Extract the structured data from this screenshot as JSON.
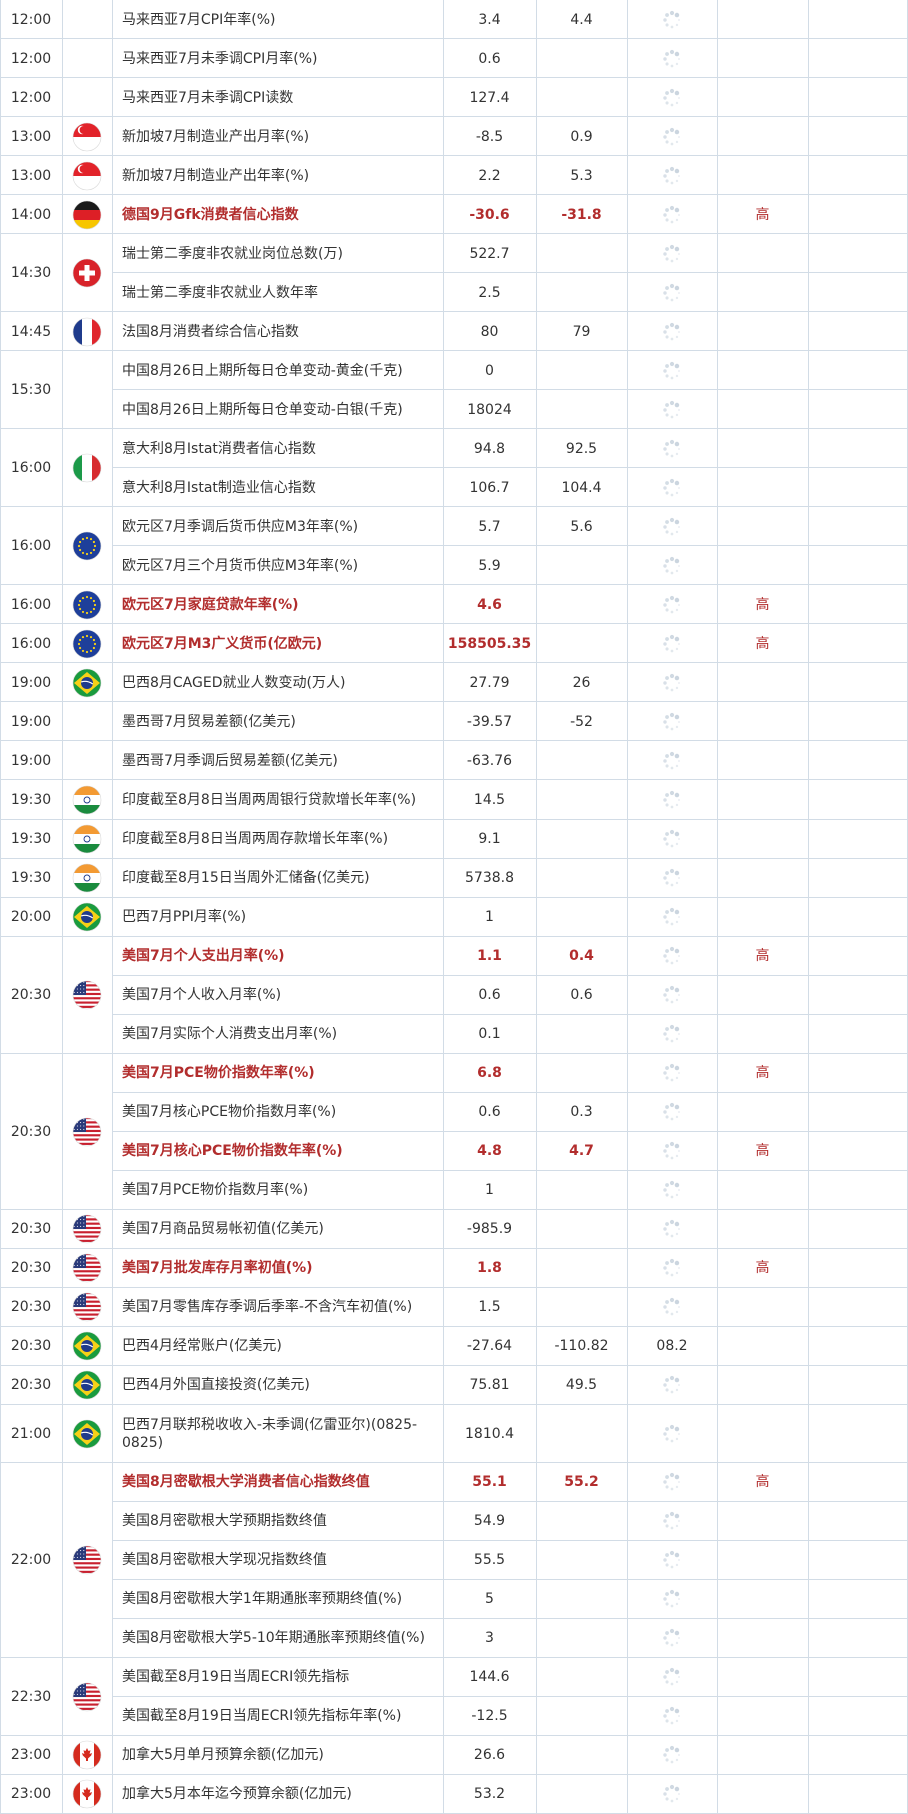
{
  "rows": [
    {
      "time": "12:00",
      "country": "",
      "name": "马来西亚7月CPI年率(%)",
      "actual": "3.4",
      "forecast": "4.4",
      "previous": "",
      "impact": "",
      "important": false
    },
    {
      "time": "12:00",
      "country": "",
      "name": "马来西亚7月未季调CPI月率(%)",
      "actual": "0.6",
      "forecast": "",
      "previous": "",
      "impact": "",
      "important": false
    },
    {
      "time": "12:00",
      "country": "",
      "name": "马来西亚7月未季调CPI读数",
      "actual": "127.4",
      "forecast": "",
      "previous": "",
      "impact": "",
      "important": false
    },
    {
      "time": "13:00",
      "country": "singapore",
      "name": "新加坡7月制造业产出月率(%)",
      "actual": "-8.5",
      "forecast": "0.9",
      "previous": "",
      "impact": "",
      "important": false
    },
    {
      "time": "13:00",
      "country": "singapore",
      "name": "新加坡7月制造业产出年率(%)",
      "actual": "2.2",
      "forecast": "5.3",
      "previous": "",
      "impact": "",
      "important": false
    },
    {
      "time": "14:00",
      "country": "germany",
      "name": "德国9月Gfk消费者信心指数",
      "actual": "-30.6",
      "forecast": "-31.8",
      "previous": "",
      "impact": "高",
      "important": true
    },
    {
      "time": "14:30",
      "country": "switzerland",
      "name": "瑞士第二季度非农就业岗位总数(万)",
      "actual": "522.7",
      "forecast": "",
      "previous": "",
      "impact": "",
      "important": false
    },
    {
      "time": "14:30",
      "country": "switzerland",
      "name": "瑞士第二季度非农就业人数年率",
      "actual": "2.5",
      "forecast": "",
      "previous": "",
      "impact": "",
      "important": false
    },
    {
      "time": "14:45",
      "country": "france",
      "name": "法国8月消费者综合信心指数",
      "actual": "80",
      "forecast": "79",
      "previous": "",
      "impact": "",
      "important": false
    },
    {
      "time": "15:30",
      "country": "",
      "name": "中国8月26日上期所每日仓单变动-黄金(千克)",
      "actual": "0",
      "forecast": "",
      "previous": "",
      "impact": "",
      "important": false
    },
    {
      "time": "15:30",
      "country": "",
      "name": "中国8月26日上期所每日仓单变动-白银(千克)",
      "actual": "18024",
      "forecast": "",
      "previous": "",
      "impact": "",
      "important": false
    },
    {
      "time": "16:00",
      "country": "italy",
      "name": "意大利8月Istat消费者信心指数",
      "actual": "94.8",
      "forecast": "92.5",
      "previous": "",
      "impact": "",
      "important": false
    },
    {
      "time": "16:00",
      "country": "italy",
      "name": "意大利8月Istat制造业信心指数",
      "actual": "106.7",
      "forecast": "104.4",
      "previous": "",
      "impact": "",
      "important": false
    },
    {
      "time": "16:00",
      "country": "eu",
      "name": "欧元区7月季调后货币供应M3年率(%)",
      "actual": "5.7",
      "forecast": "5.6",
      "previous": "",
      "impact": "",
      "important": false
    },
    {
      "time": "16:00",
      "country": "eu",
      "name": "欧元区7月三个月货币供应M3年率(%)",
      "actual": "5.9",
      "forecast": "",
      "previous": "",
      "impact": "",
      "important": false
    },
    {
      "time": "16:00",
      "country": "eu",
      "name": "欧元区7月家庭贷款年率(%)",
      "actual": "4.6",
      "forecast": "",
      "previous": "",
      "impact": "高",
      "important": true
    },
    {
      "time": "16:00",
      "country": "eu",
      "name": "欧元区7月M3广义货币(亿欧元)",
      "actual": "158505.35",
      "forecast": "",
      "previous": "",
      "impact": "高",
      "important": true
    },
    {
      "time": "19:00",
      "country": "brazil",
      "name": "巴西8月CAGED就业人数变动(万人)",
      "actual": "27.79",
      "forecast": "26",
      "previous": "",
      "impact": "",
      "important": false
    },
    {
      "time": "19:00",
      "country": "",
      "name": "墨西哥7月贸易差额(亿美元)",
      "actual": "-39.57",
      "forecast": "-52",
      "previous": "",
      "impact": "",
      "important": false
    },
    {
      "time": "19:00",
      "country": "",
      "name": "墨西哥7月季调后贸易差额(亿美元)",
      "actual": "-63.76",
      "forecast": "",
      "previous": "",
      "impact": "",
      "important": false
    },
    {
      "time": "19:30",
      "country": "india",
      "name": "印度截至8月8日当周两周银行贷款增长年率(%)",
      "actual": "14.5",
      "forecast": "",
      "previous": "",
      "impact": "",
      "important": false
    },
    {
      "time": "19:30",
      "country": "india",
      "name": "印度截至8月8日当周两周存款增长年率(%)",
      "actual": "9.1",
      "forecast": "",
      "previous": "",
      "impact": "",
      "important": false
    },
    {
      "time": "19:30",
      "country": "india",
      "name": "印度截至8月15日当周外汇储备(亿美元)",
      "actual": "5738.8",
      "forecast": "",
      "previous": "",
      "impact": "",
      "important": false
    },
    {
      "time": "20:00",
      "country": "brazil",
      "name": "巴西7月PPI月率(%)",
      "actual": "1",
      "forecast": "",
      "previous": "",
      "impact": "",
      "important": false
    },
    {
      "time": "20:30",
      "country": "usa",
      "name": "美国7月个人支出月率(%)",
      "actual": "1.1",
      "forecast": "0.4",
      "previous": "",
      "impact": "高",
      "important": true
    },
    {
      "time": "20:30",
      "country": "usa",
      "name": "美国7月个人收入月率(%)",
      "actual": "0.6",
      "forecast": "0.6",
      "previous": "",
      "impact": "",
      "important": false
    },
    {
      "time": "20:30",
      "country": "usa",
      "name": "美国7月实际个人消费支出月率(%)",
      "actual": "0.1",
      "forecast": "",
      "previous": "",
      "impact": "",
      "important": false
    },
    {
      "time": "20:30",
      "country": "usa",
      "name": "美国7月PCE物价指数年率(%)",
      "actual": "6.8",
      "forecast": "",
      "previous": "",
      "impact": "高",
      "important": true
    },
    {
      "time": "20:30",
      "country": "usa",
      "name": "美国7月核心PCE物价指数月率(%)",
      "actual": "0.6",
      "forecast": "0.3",
      "previous": "",
      "impact": "",
      "important": false
    },
    {
      "time": "20:30",
      "country": "usa",
      "name": "美国7月核心PCE物价指数年率(%)",
      "actual": "4.8",
      "forecast": "4.7",
      "previous": "",
      "impact": "高",
      "important": true
    },
    {
      "time": "20:30",
      "country": "usa",
      "name": "美国7月PCE物价指数月率(%)",
      "actual": "1",
      "forecast": "",
      "previous": "",
      "impact": "",
      "important": false
    },
    {
      "time": "20:30",
      "country": "usa",
      "name": "美国7月商品贸易帐初值(亿美元)",
      "actual": "-985.9",
      "forecast": "",
      "previous": "",
      "impact": "",
      "important": false
    },
    {
      "time": "20:30",
      "country": "usa",
      "name": "美国7月批发库存月率初值(%)",
      "actual": "1.8",
      "forecast": "",
      "previous": "",
      "impact": "高",
      "important": true
    },
    {
      "time": "20:30",
      "country": "usa",
      "name": "美国7月零售库存季调后季率-不含汽车初值(%)",
      "actual": "1.5",
      "forecast": "",
      "previous": "",
      "impact": "",
      "important": false
    },
    {
      "time": "20:30",
      "country": "brazil",
      "name": "巴西4月经常账户(亿美元)",
      "actual": "-27.64",
      "forecast": "-110.82",
      "previous": "08.2",
      "impact": "",
      "important": false
    },
    {
      "time": "20:30",
      "country": "brazil",
      "name": "巴西4月外国直接投资(亿美元)",
      "actual": "75.81",
      "forecast": "49.5",
      "previous": "",
      "impact": "",
      "important": false
    },
    {
      "time": "21:00",
      "country": "brazil",
      "name": "巴西7月联邦税收收入-未季调(亿雷亚尔)(0825-0825)",
      "actual": "1810.4",
      "forecast": "",
      "previous": "",
      "impact": "",
      "important": false
    },
    {
      "time": "22:00",
      "country": "usa",
      "name": "美国8月密歇根大学消费者信心指数终值",
      "actual": "55.1",
      "forecast": "55.2",
      "previous": "",
      "impact": "高",
      "important": true
    },
    {
      "time": "22:00",
      "country": "usa",
      "name": "美国8月密歇根大学预期指数终值",
      "actual": "54.9",
      "forecast": "",
      "previous": "",
      "impact": "",
      "important": false
    },
    {
      "time": "22:00",
      "country": "usa",
      "name": "美国8月密歇根大学现况指数终值",
      "actual": "55.5",
      "forecast": "",
      "previous": "",
      "impact": "",
      "important": false
    },
    {
      "time": "22:00",
      "country": "usa",
      "name": "美国8月密歇根大学1年期通胀率预期终值(%)",
      "actual": "5",
      "forecast": "",
      "previous": "",
      "impact": "",
      "important": false
    },
    {
      "time": "22:00",
      "country": "usa",
      "name": "美国8月密歇根大学5-10年期通胀率预期终值(%)",
      "actual": "3",
      "forecast": "",
      "previous": "",
      "impact": "",
      "important": false
    },
    {
      "time": "22:30",
      "country": "usa",
      "name": "美国截至8月19日当周ECRI领先指标",
      "actual": "144.6",
      "forecast": "",
      "previous": "",
      "impact": "",
      "important": false
    },
    {
      "time": "22:30",
      "country": "usa",
      "name": "美国截至8月19日当周ECRI领先指标年率(%)",
      "actual": "-12.5",
      "forecast": "",
      "previous": "",
      "impact": "",
      "important": false
    },
    {
      "time": "23:00",
      "country": "canada",
      "name": "加拿大5月单月预算余额(亿加元)",
      "actual": "26.6",
      "forecast": "",
      "previous": "",
      "impact": "",
      "important": false
    },
    {
      "time": "23:00",
      "country": "canada",
      "name": "加拿大5月本年迄今预算余额(亿加元)",
      "actual": "53.2",
      "forecast": "",
      "previous": "",
      "impact": "",
      "important": false
    }
  ],
  "groups": [
    {
      "first": 0,
      "last": 0,
      "time": "12:00",
      "country": ""
    },
    {
      "first": 1,
      "last": 1,
      "time": "12:00",
      "country": ""
    },
    {
      "first": 2,
      "last": 2,
      "time": "12:00",
      "country": ""
    },
    {
      "first": 3,
      "last": 3,
      "time": "13:00",
      "country": "singapore"
    },
    {
      "first": 4,
      "last": 4,
      "time": "13:00",
      "country": "singapore"
    },
    {
      "first": 5,
      "last": 5,
      "time": "14:00",
      "country": "germany"
    },
    {
      "first": 6,
      "last": 7,
      "time": "14:30",
      "country": "switzerland"
    },
    {
      "first": 8,
      "last": 8,
      "time": "14:45",
      "country": "france"
    },
    {
      "first": 9,
      "last": 10,
      "time": "15:30",
      "country": ""
    },
    {
      "first": 11,
      "last": 12,
      "time": "16:00",
      "country": "italy"
    },
    {
      "first": 13,
      "last": 14,
      "time": "16:00",
      "country": "eu"
    },
    {
      "first": 15,
      "last": 15,
      "time": "16:00",
      "country": "eu"
    },
    {
      "first": 16,
      "last": 16,
      "time": "16:00",
      "country": "eu"
    },
    {
      "first": 17,
      "last": 17,
      "time": "19:00",
      "country": "brazil"
    },
    {
      "first": 18,
      "last": 18,
      "time": "19:00",
      "country": ""
    },
    {
      "first": 19,
      "last": 19,
      "time": "19:00",
      "country": ""
    },
    {
      "first": 20,
      "last": 20,
      "time": "19:30",
      "country": "india"
    },
    {
      "first": 21,
      "last": 21,
      "time": "19:30",
      "country": "india"
    },
    {
      "first": 22,
      "last": 22,
      "time": "19:30",
      "country": "india"
    },
    {
      "first": 23,
      "last": 23,
      "time": "20:00",
      "country": "brazil"
    },
    {
      "first": 24,
      "last": 26,
      "time": "20:30",
      "country": "usa"
    },
    {
      "first": 27,
      "last": 30,
      "time": "20:30",
      "country": "usa"
    },
    {
      "first": 31,
      "last": 31,
      "time": "20:30",
      "country": "usa"
    },
    {
      "first": 32,
      "last": 32,
      "time": "20:30",
      "country": "usa"
    },
    {
      "first": 33,
      "last": 33,
      "time": "20:30",
      "country": "usa"
    },
    {
      "first": 34,
      "last": 34,
      "time": "20:30",
      "country": "brazil"
    },
    {
      "first": 35,
      "last": 35,
      "time": "20:30",
      "country": "brazil"
    },
    {
      "first": 36,
      "last": 36,
      "time": "21:00",
      "country": "brazil"
    },
    {
      "first": 37,
      "last": 41,
      "time": "22:00",
      "country": "usa"
    },
    {
      "first": 42,
      "last": 43,
      "time": "22:30",
      "country": "usa"
    },
    {
      "first": 44,
      "last": 44,
      "time": "23:00",
      "country": "canada"
    },
    {
      "first": 45,
      "last": 45,
      "time": "23:00",
      "country": "canada"
    }
  ],
  "colors": {
    "important_text": "#b22d2d",
    "normal_text": "#333333",
    "grid": "#d2dce6"
  }
}
